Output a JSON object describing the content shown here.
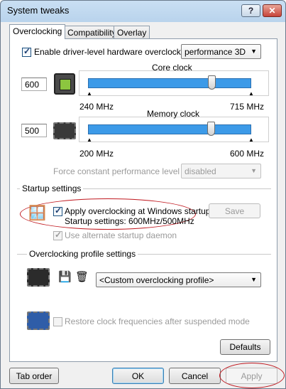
{
  "window": {
    "title": "System tweaks",
    "help_label": "?",
    "close_label": "✕"
  },
  "tabs": [
    {
      "label": "Overclocking",
      "active": true
    },
    {
      "label": "Compatibility",
      "active": false
    },
    {
      "label": "Overlay",
      "active": false
    }
  ],
  "overclocking": {
    "enable_label": "Enable driver-level hardware overclocking",
    "enable_checked": true,
    "profile_select": "performance 3D",
    "core": {
      "title": "Core clock",
      "value": "600",
      "min_label": "240 MHz",
      "max_label": "715 MHz",
      "min": 240,
      "max": 715,
      "current": 600
    },
    "memory": {
      "title": "Memory clock",
      "value": "500",
      "min_label": "200 MHz",
      "max_label": "600 MHz",
      "min": 200,
      "max": 600,
      "current": 500
    },
    "force_label": "Force constant performance level",
    "force_select": "disabled"
  },
  "startup": {
    "section_label": "Startup settings",
    "apply_label": "Apply overclocking at Windows startup",
    "apply_checked": true,
    "settings_text": "Startup settings: 600MHz/500MHz",
    "save_label": "Save",
    "daemon_label": "Use alternate startup daemon",
    "daemon_checked": true
  },
  "profiles": {
    "section_label": "Overclocking profile settings",
    "profile_select": "<Custom overclocking profile>"
  },
  "restore": {
    "label": "Restore clock frequencies after suspended mode",
    "checked": false
  },
  "buttons": {
    "defaults": "Defaults",
    "tab_order": "Tab order",
    "ok": "OK",
    "cancel": "Cancel",
    "apply": "Apply"
  },
  "colors": {
    "slider_fill": "#3c9ae8",
    "annotation": "#c0181f"
  }
}
